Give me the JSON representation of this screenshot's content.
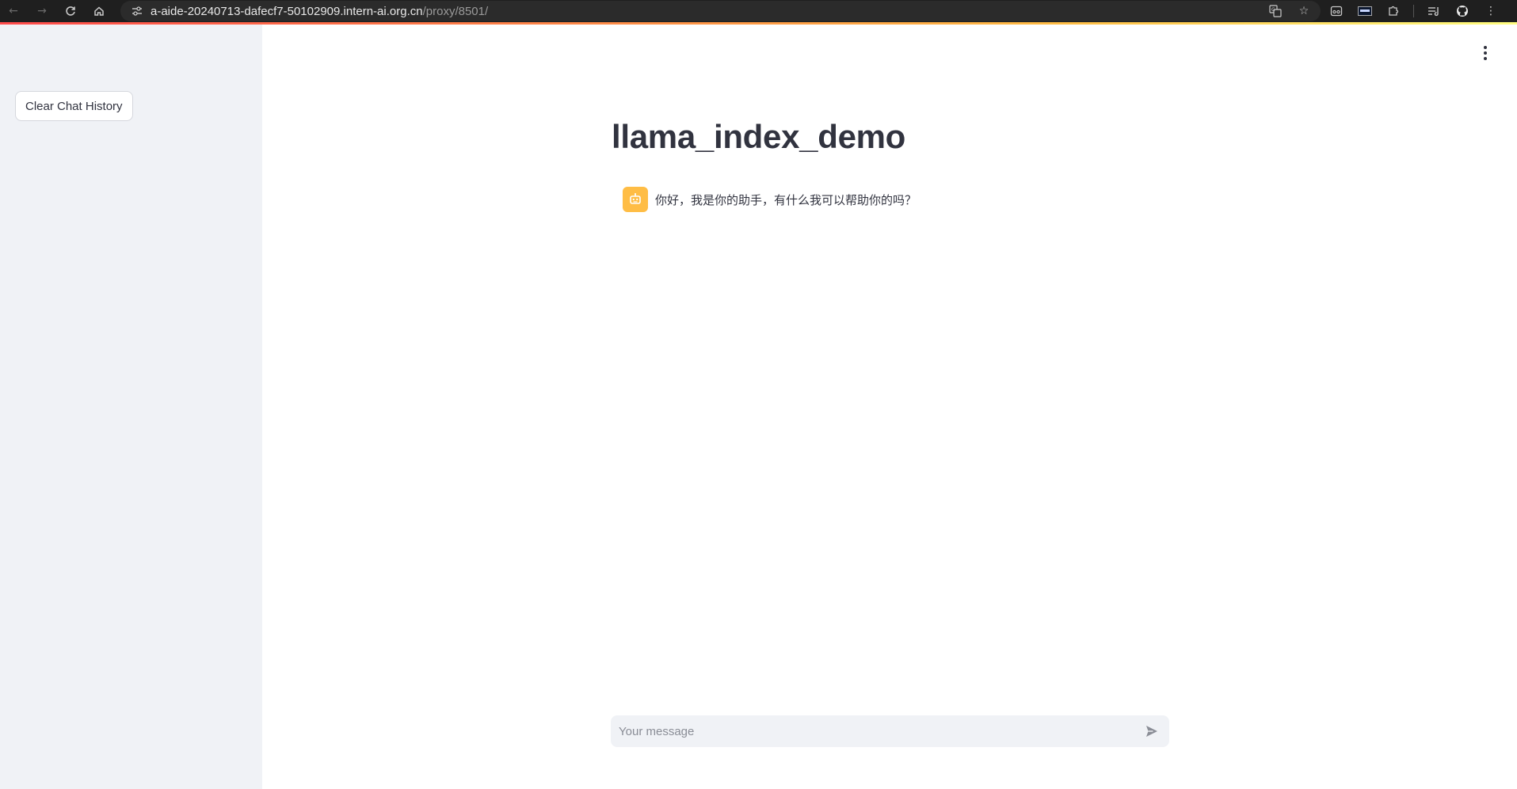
{
  "browser": {
    "url_host": "a-aide-20240713-dafecf7-50102909.intern-ai.org.cn",
    "url_path": "/proxy/8501/",
    "nav_icons": [
      "back-icon",
      "forward-icon",
      "reload-icon",
      "home-icon"
    ],
    "toolbar_icons": [
      "translate-icon",
      "bookmark-star-icon",
      "extension-icon",
      "extension-icon",
      "extensions-puzzle-icon",
      "reading-list-icon",
      "github-icon",
      "menu-icon"
    ]
  },
  "sidebar": {
    "clear_button_label": "Clear Chat History"
  },
  "main": {
    "title": "llama_index_demo",
    "messages": [
      {
        "role": "assistant",
        "avatar": "robot-icon",
        "text": "你好，我是你的助手，有什么我可以帮助你的吗？"
      }
    ],
    "chat_input": {
      "placeholder": "Your message",
      "value": ""
    }
  },
  "colors": {
    "sidebar_bg": "#f0f2f6",
    "avatar_bg": "#ffbd45",
    "text": "#31333f",
    "accent_start": "#ff4b4b",
    "accent_end": "#fffd80"
  }
}
